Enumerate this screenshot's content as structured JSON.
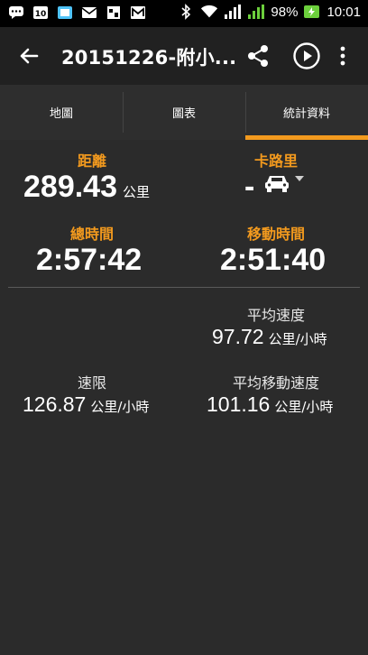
{
  "status_bar": {
    "battery_percent": "98%",
    "clock": "10:01",
    "icons": [
      "chat-icon",
      "notification-icon",
      "image-icon",
      "mail-icon",
      "gallery-icon",
      "mail-m-icon",
      "bluetooth-icon",
      "wifi-icon",
      "signal-1-icon",
      "signal-2-icon",
      "battery-charging-icon"
    ]
  },
  "toolbar": {
    "title": "20151226-附小...",
    "back_icon": "back-arrow-icon",
    "share_icon": "share-icon",
    "play_icon": "play-icon",
    "more_icon": "more-vert-icon"
  },
  "tabs": [
    {
      "label": "地圖",
      "active": false
    },
    {
      "label": "圖表",
      "active": false
    },
    {
      "label": "統計資料",
      "active": true
    }
  ],
  "stats": {
    "distance": {
      "label": "距離",
      "value": "289.43",
      "unit": "公里"
    },
    "calories": {
      "label": "卡路里",
      "value": "-",
      "icon": "car-icon"
    },
    "total_time": {
      "label": "總時間",
      "value": "2:57:42"
    },
    "moving_time": {
      "label": "移動時間",
      "value": "2:51:40"
    },
    "avg_speed": {
      "label": "平均速度",
      "value": "97.72",
      "unit": "公里/小時"
    },
    "speed_limit": {
      "label": "速限",
      "value": "126.87",
      "unit": "公里/小時"
    },
    "avg_moving_speed": {
      "label": "平均移動速度",
      "value": "101.16",
      "unit": "公里/小時"
    }
  },
  "colors": {
    "accent": "#f39a1e",
    "background": "#2b2b2b",
    "toolbar": "#212121"
  }
}
